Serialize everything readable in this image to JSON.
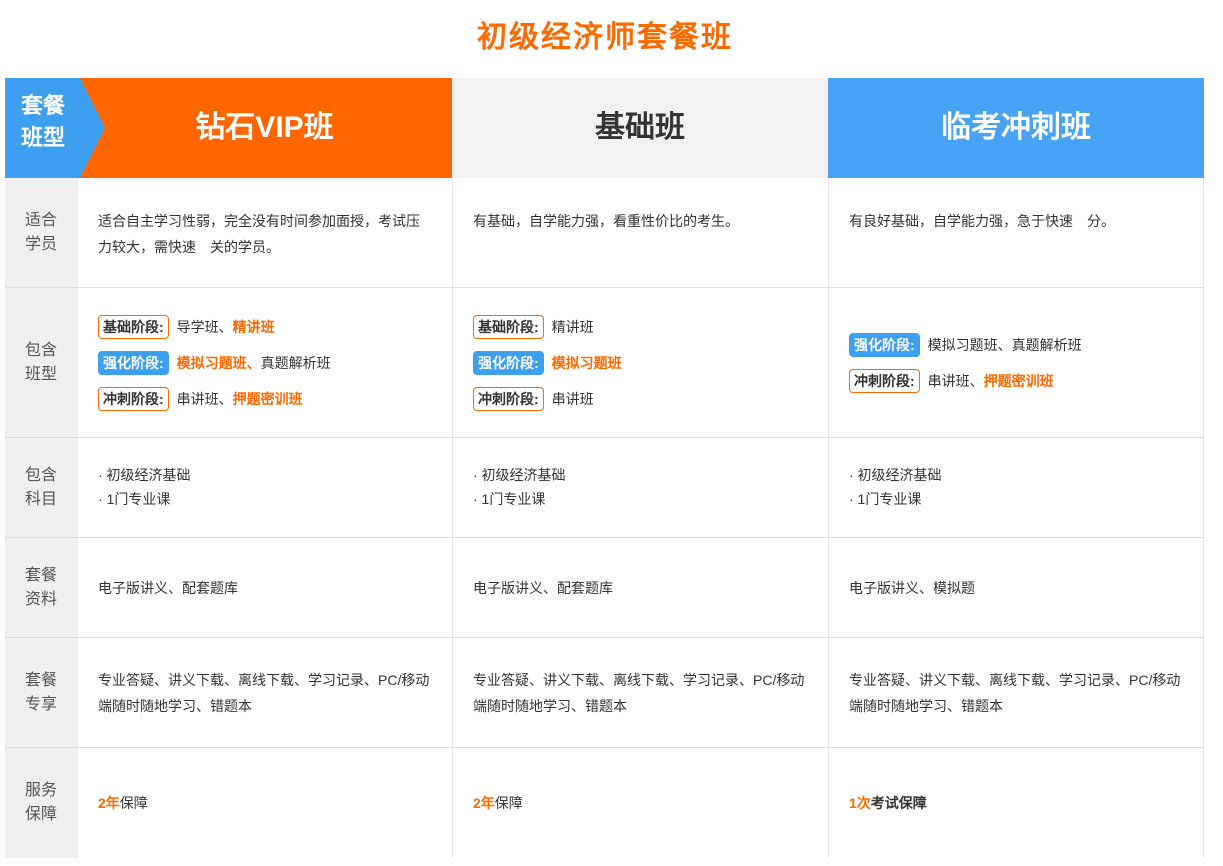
{
  "title": "初级经济师套餐班",
  "header": {
    "label_line1": "套餐",
    "label_line2": "班型",
    "plans": [
      "钻石VIP班",
      "基础班",
      "临考冲刺班"
    ]
  },
  "rows": {
    "students": {
      "label_line1": "适合",
      "label_line2": "学员",
      "values": [
        "适合自主学习性弱，完全没有时间参加面授，考试压力较大，需快速　关的学员。",
        "有基础，自学能力强，看重性价比的考生。",
        "有良好基础，自学能力强，急于快速　分。"
      ]
    },
    "classes": {
      "label_line1": "包含",
      "label_line2": "班型",
      "vip": [
        {
          "badge": "基础阶段:",
          "text": "导学班、",
          "highlight": "精讲班",
          "after": ""
        },
        {
          "badge": "强化阶段:",
          "text": "",
          "highlight": "模拟习题班、",
          "after": "真题解析班"
        },
        {
          "badge": "冲刺阶段:",
          "text": "串讲班、",
          "highlight": "押题密训班",
          "after": ""
        }
      ],
      "basic": [
        {
          "badge": "基础阶段:",
          "text": "精讲班",
          "highlight": "",
          "after": ""
        },
        {
          "badge": "强化阶段:",
          "text": "",
          "highlight": "模拟习题班",
          "after": ""
        },
        {
          "badge": "冲刺阶段:",
          "text": "串讲班",
          "highlight": "",
          "after": ""
        }
      ],
      "sprint": [
        {
          "badge": "强化阶段:",
          "text": "模拟习题班、真题解析班",
          "highlight": "",
          "after": ""
        },
        {
          "badge": "冲刺阶段:",
          "text": "串讲班、",
          "highlight": "押题密训班",
          "after": ""
        }
      ]
    },
    "subjects": {
      "label_line1": "包含",
      "label_line2": "科目",
      "items": [
        "· 初级经济基础",
        "· 1门专业课"
      ]
    },
    "materials": {
      "label_line1": "套餐",
      "label_line2": "资料",
      "values": [
        "电子版讲义、配套题库",
        "电子版讲义、配套题库",
        "电子版讲义、模拟题"
      ]
    },
    "perks": {
      "label_line1": "套餐",
      "label_line2": "专享",
      "value": "专业答疑、讲义下载、离线下载、学习记录、PC/移动端随时随地学习、错题本"
    },
    "guarantee": {
      "label_line1": "服务",
      "label_line2": "保障",
      "vip": {
        "highlight": "2年",
        "text": "保障"
      },
      "basic": {
        "highlight": "2年",
        "text": "保障"
      },
      "sprint": {
        "highlight": "1次",
        "text": "考试保障"
      }
    }
  },
  "colors": {
    "orange": "#ff6600",
    "blue": "#3c9ff0",
    "gray": "#f2f2f2"
  }
}
